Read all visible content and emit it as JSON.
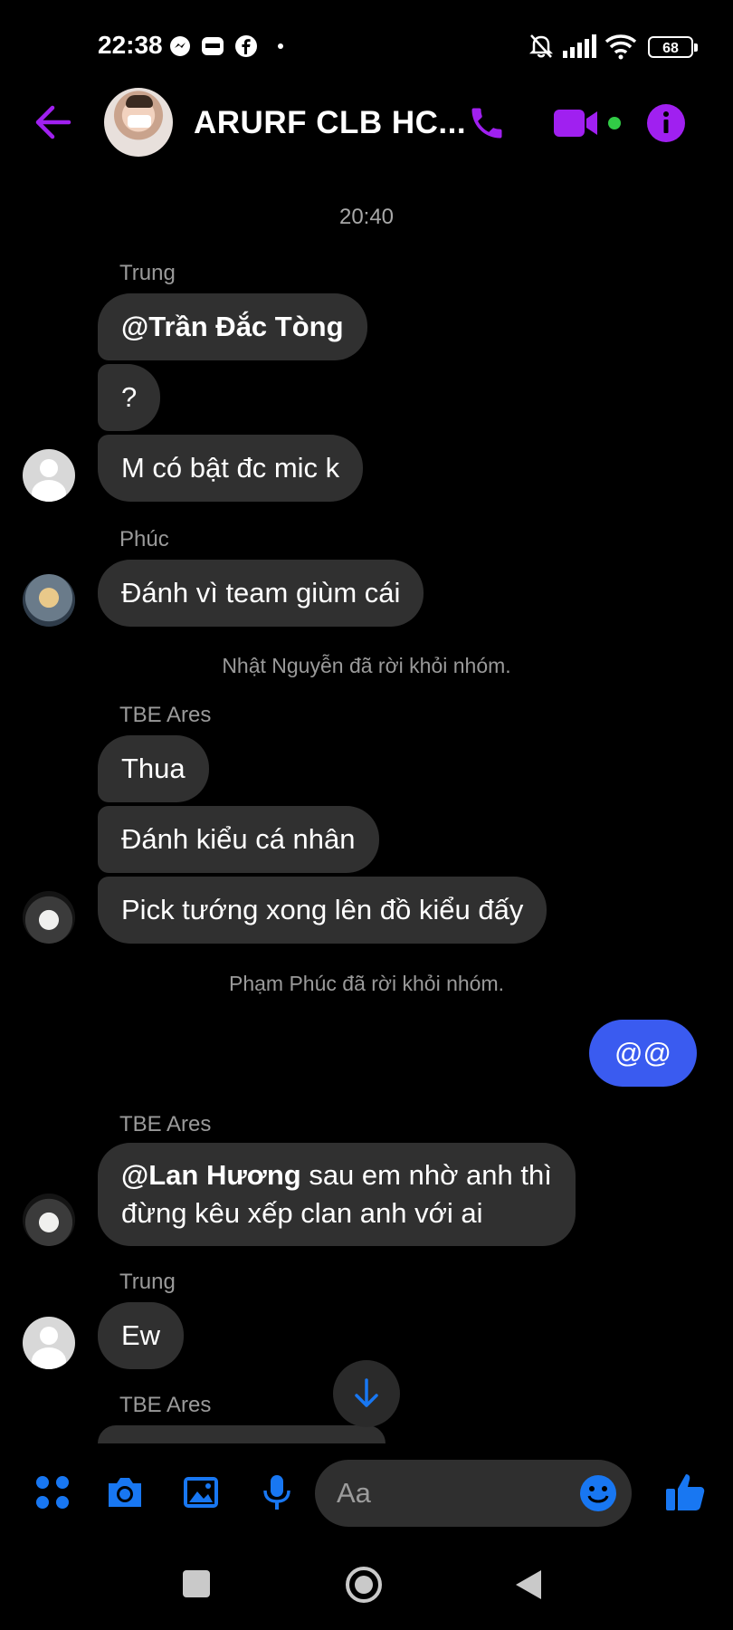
{
  "status_bar": {
    "time": "22:38",
    "battery": "68"
  },
  "header": {
    "title": "ARURF CLB HC..."
  },
  "conversation": {
    "time_separator": "20:40",
    "groups": [
      {
        "sender": "Trung",
        "messages": [
          {
            "mention": "@Trần Đắc Tòng",
            "text": ""
          },
          {
            "text": "?"
          },
          {
            "text": "M có bật đc mic k"
          }
        ]
      },
      {
        "sender": "Phúc",
        "messages": [
          {
            "text": "Đánh vì team giùm cái"
          }
        ]
      },
      {
        "system": "Nhật Nguyễn đã rời khỏi nhóm."
      },
      {
        "sender": "TBE Ares",
        "messages": [
          {
            "text": "Thua"
          },
          {
            "text": "Đánh kiểu cá nhân"
          },
          {
            "text": "Pick tướng xong lên đồ kiểu đấy"
          }
        ]
      },
      {
        "system": "Phạm Phúc đã rời khỏi nhóm."
      },
      {
        "outgoing": "@@"
      },
      {
        "sender": "TBE Ares",
        "messages": [
          {
            "mention": "@Lan Hương",
            "text": " sau em nhờ anh thì",
            "line2": "đừng kêu xếp clan anh với ai"
          }
        ]
      },
      {
        "sender": "Trung",
        "messages": [
          {
            "text": "Ew"
          }
        ]
      },
      {
        "sender": "TBE Ares",
        "messages": []
      }
    ]
  },
  "composer": {
    "placeholder": "Aa"
  },
  "colors": {
    "accent": "#a020f0",
    "messenger_blue": "#1877f2",
    "outgoing_bubble": "#3a5bf0",
    "incoming_bubble": "#303030"
  }
}
